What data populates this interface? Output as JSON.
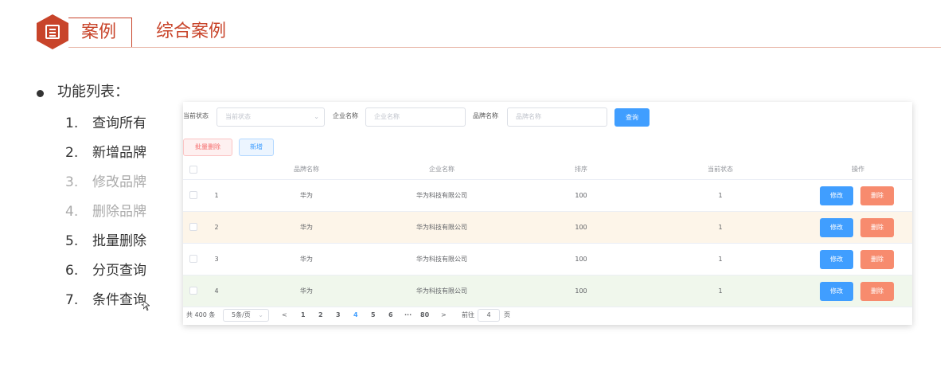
{
  "header": {
    "tag": "案例",
    "title": "综合案例"
  },
  "features": {
    "heading": "功能列表：",
    "items": [
      {
        "num": "1.",
        "label": "查询所有"
      },
      {
        "num": "2.",
        "label": "新增品牌"
      },
      {
        "num": "3.",
        "label": "修改品牌"
      },
      {
        "num": "4.",
        "label": "删除品牌"
      },
      {
        "num": "5.",
        "label": "批量删除"
      },
      {
        "num": "6.",
        "label": "分页查询"
      },
      {
        "num": "7.",
        "label": "条件查询"
      }
    ]
  },
  "filters": {
    "status_label": "当前状态",
    "status_placeholder": "当前状态",
    "company_label": "企业名称",
    "company_placeholder": "企业名称",
    "brand_label": "品牌名称",
    "brand_placeholder": "品牌名称",
    "query_button": "查询"
  },
  "actions": {
    "batch_delete": "批量删除",
    "add": "新增"
  },
  "table": {
    "headers": [
      "品牌名称",
      "企业名称",
      "排序",
      "当前状态",
      "操作"
    ],
    "rows": [
      {
        "index": "1",
        "brand": "华为",
        "company": "华为科技有限公司",
        "order": "100",
        "status": "1",
        "edit": "修改",
        "delete": "删除"
      },
      {
        "index": "2",
        "brand": "华为",
        "company": "华为科技有限公司",
        "order": "100",
        "status": "1",
        "edit": "修改",
        "delete": "删除"
      },
      {
        "index": "3",
        "brand": "华为",
        "company": "华为科技有限公司",
        "order": "100",
        "status": "1",
        "edit": "修改",
        "delete": "删除"
      },
      {
        "index": "4",
        "brand": "华为",
        "company": "华为科技有限公司",
        "order": "100",
        "status": "1",
        "edit": "修改",
        "delete": "删除"
      }
    ],
    "row_colors": [
      "#ffffff",
      "#fdf5e9",
      "#ffffff",
      "#f0f7ec"
    ]
  },
  "pagination": {
    "total": "共 400 条",
    "page_size": "5条/页",
    "prev": "<",
    "pages": [
      "1",
      "2",
      "3",
      "4",
      "5",
      "6",
      "···",
      "80"
    ],
    "active_page": "4",
    "next": ">",
    "goto_label": "前往",
    "goto_value": "4",
    "goto_suffix": "页"
  },
  "colors": {
    "accent": "#c8442a",
    "primary": "#409eff",
    "danger": "#f78b6e"
  }
}
